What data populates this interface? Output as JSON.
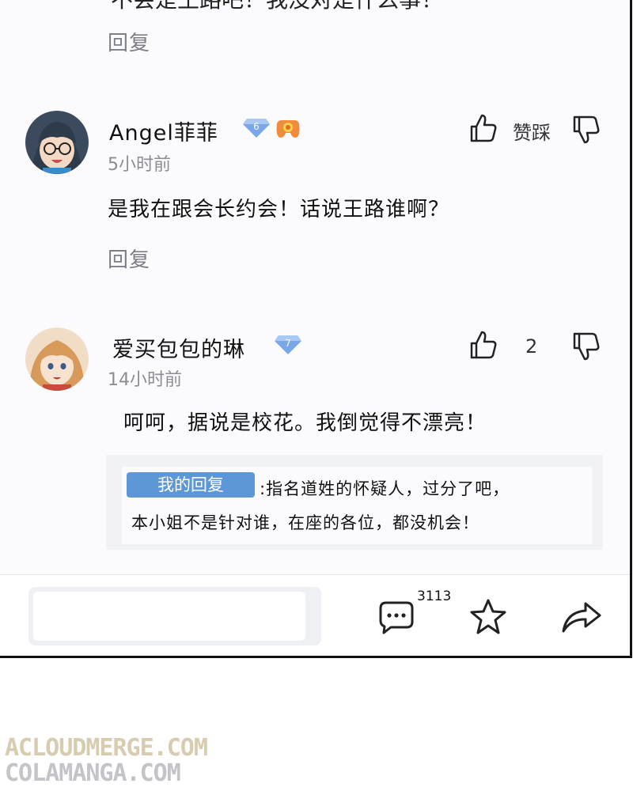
{
  "top_partial": {
    "text": "不会是王路吧！我没对是什么事！",
    "reply_label": "回复"
  },
  "comments": [
    {
      "username": "Angel菲菲",
      "level": "6",
      "time": "5小时前",
      "text": "是我在跟会长约会！话说王路谁啊？",
      "vote_label": "赞踩",
      "reply_label": "回复"
    },
    {
      "username": "爱买包包的琳",
      "level": "7",
      "time": "14小时前",
      "text": "呵呵，据说是校花。我倒觉得不漂亮！",
      "vote_count": "2",
      "my_reply": {
        "tag": "我的回复",
        "line1": ":指名道姓的怀疑人，过分了吧，",
        "line2": "本小姐不是针对谁，在座的各位，都没机会！"
      }
    }
  ],
  "bottom_bar": {
    "comment_count": "3113",
    "input_placeholder": ""
  },
  "watermark": {
    "line1": "ACLOUDMERGE.COM",
    "line2": "COLAMANGA.COM"
  },
  "colors": {
    "level_badge": "#7aa7ea",
    "reply_tag": "#5e97d6",
    "watermark": "#d8ccb0"
  }
}
